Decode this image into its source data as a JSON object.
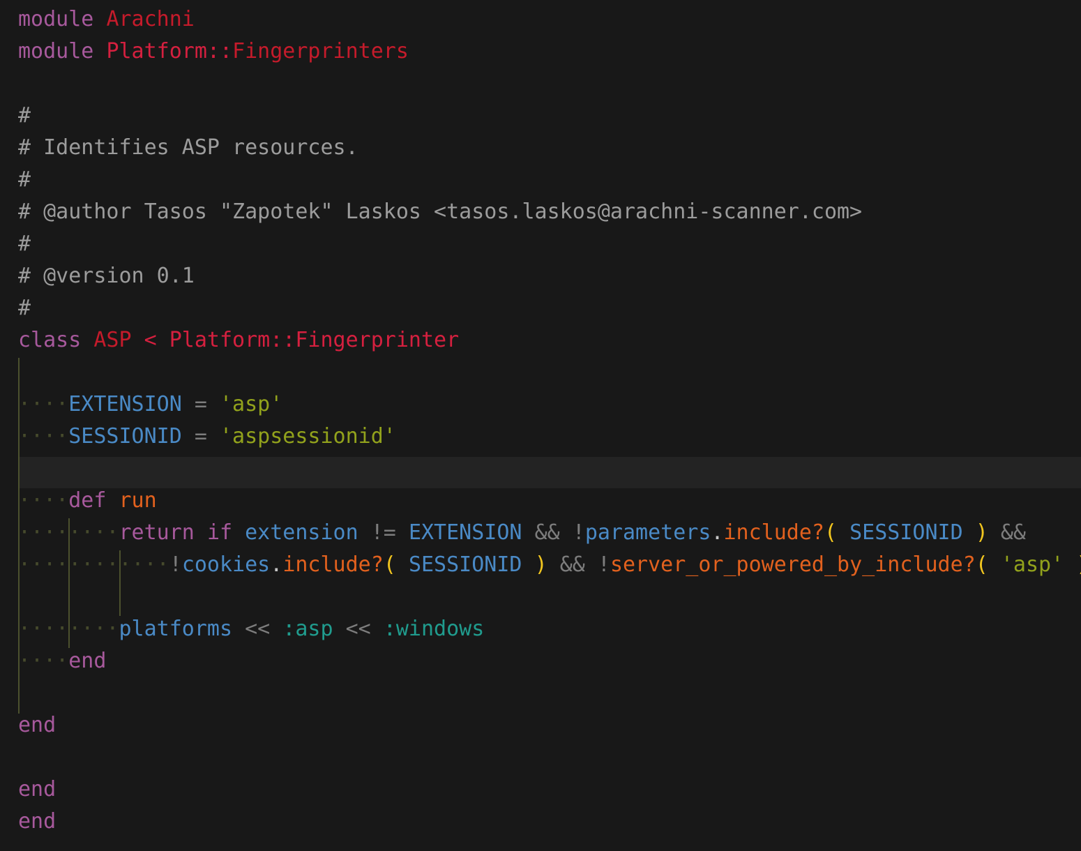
{
  "editor": {
    "indent_marker": "····",
    "lines": [
      {
        "module_kw": "module",
        "name": "Arachni"
      },
      {
        "module_kw": "module",
        "ns": "Platform",
        "sep": "::",
        "name": "Fingerprinters"
      },
      {
        "comment": "#"
      },
      {
        "comment": "# Identifies ASP resources."
      },
      {
        "comment": "#"
      },
      {
        "comment": "# @author Tasos \"Zapotek\" Laskos <tasos.laskos@arachni-scanner.com>"
      },
      {
        "comment": "#"
      },
      {
        "comment": "# @version 0.1"
      },
      {
        "comment": "#"
      },
      {
        "class_kw": "class",
        "name": "ASP",
        "lt": "<",
        "parent": "Platform::Fingerprinter"
      },
      {
        "const": "EXTENSION",
        "eq": "=",
        "value": "'asp'"
      },
      {
        "const": "SESSIONID",
        "eq": "=",
        "value": "'aspsessionid'"
      },
      {
        "def_kw": "def",
        "method": "run"
      },
      {
        "return_kw": "return",
        "if_kw": "if",
        "ident": "extension",
        "neq": "!=",
        "const": "EXTENSION",
        "and": "&&",
        "not": "!",
        "obj": "parameters",
        "dot": ".",
        "call": "include?",
        "lp": "(",
        "arg": "SESSIONID",
        "rp": ")",
        "and2": "&&"
      },
      {
        "not": "!",
        "obj": "cookies",
        "dot": ".",
        "call": "include?",
        "lp": "(",
        "arg": "SESSIONID",
        "rp": ")",
        "and": "&&",
        "not2": "!",
        "call2": "server_or_powered_by_include?",
        "lp2": "(",
        "arg2": "'asp'",
        "rp2": ")"
      },
      {
        "ident": "platforms",
        "op": "<<",
        "sym1": ":asp",
        "op2": "<<",
        "sym2": ":windows"
      },
      {
        "end_kw": "end"
      },
      {
        "end_kw": "end"
      },
      {
        "end_kw": "end"
      },
      {
        "end_kw": "end"
      }
    ]
  }
}
